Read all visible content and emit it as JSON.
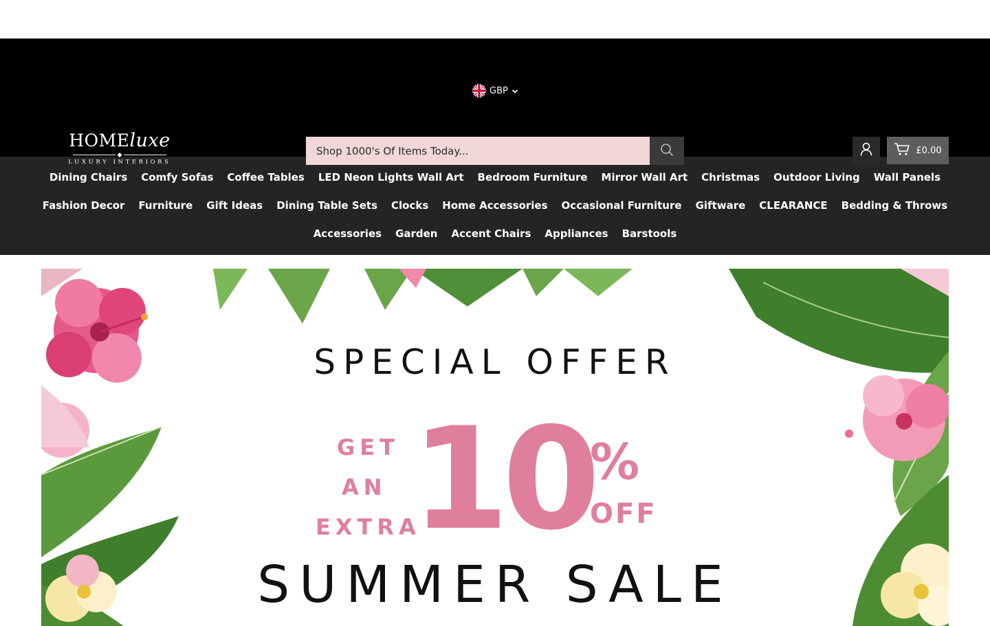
{
  "currency": {
    "code": "GBP",
    "flag_icon": "uk-flag-icon"
  },
  "logo": {
    "main_home": "HOME",
    "main_luxe": "luxe",
    "sub": "LUXURY INTERIORS"
  },
  "search": {
    "placeholder": "Shop 1000's Of Items Today..."
  },
  "cart": {
    "total": "£0.00"
  },
  "nav": {
    "rows": [
      [
        "Dining Chairs",
        "Comfy Sofas",
        "Coffee Tables",
        "LED Neon Lights Wall Art",
        "Bedroom Furniture",
        "Mirror Wall Art",
        "Christmas",
        "Outdoor Living",
        "Wall Panels"
      ],
      [
        "Fashion Decor",
        "Furniture",
        "Gift Ideas",
        "Dining Table Sets",
        "Clocks",
        "Home Accessories",
        "Occasional Furniture",
        "Giftware",
        "CLEARANCE",
        "Bedding & Throws"
      ],
      [
        "Accessories",
        "Garden",
        "Accent Chairs",
        "Appliances",
        "Barstools"
      ]
    ]
  },
  "banner": {
    "line1": "SPECIAL OFFER",
    "get": "GET",
    "an": "AN",
    "extra": "EXTRA",
    "number": "10",
    "percent": "%",
    "off": "OFF",
    "line2": "SUMMER SALE"
  },
  "colors": {
    "header_bg": "#000000",
    "nav_bg": "#242424",
    "search_bg": "#f1d7d7",
    "cart_bg": "#5d5d5d",
    "accent_pink": "#e07f9c"
  }
}
